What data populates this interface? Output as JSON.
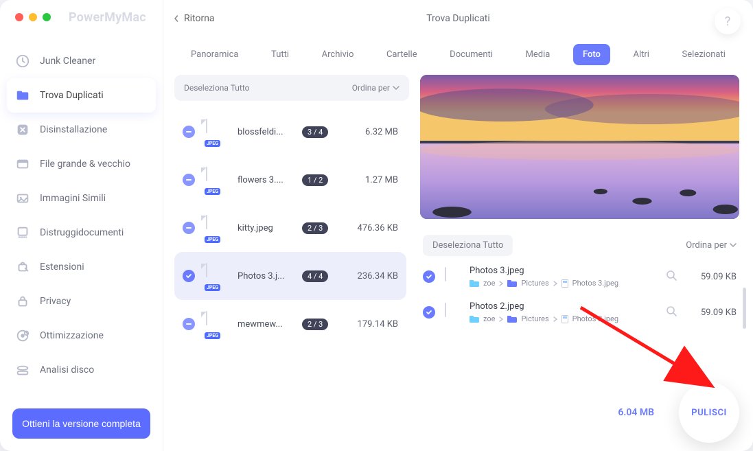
{
  "brand": "PowerMyMac",
  "back_label": "Ritorna",
  "page_title": "Trova Duplicati",
  "help_label": "?",
  "sidebar": {
    "items": [
      {
        "label": "Junk Cleaner"
      },
      {
        "label": "Trova Duplicati"
      },
      {
        "label": "Disinstallazione"
      },
      {
        "label": "File grande & vecchio"
      },
      {
        "label": "Immagini Simili"
      },
      {
        "label": "Distruggidocumenti"
      },
      {
        "label": "Estensioni"
      },
      {
        "label": "Privacy"
      },
      {
        "label": "Ottimizzazione"
      },
      {
        "label": "Analisi disco"
      }
    ],
    "cta": "Ottieni la versione completa"
  },
  "tabs": [
    "Panoramica",
    "Tutti",
    "Archivio",
    "Cartelle",
    "Documenti",
    "Media",
    "Foto",
    "Altri",
    "Selezionati"
  ],
  "tabs_active_index": 6,
  "left": {
    "deselect": "Deseleziona Tutto",
    "sort": "Ordina per",
    "rows": [
      {
        "name": "blossfeldi...",
        "badge": "3 / 4",
        "size": "6.32 MB",
        "state": "dash"
      },
      {
        "name": "flowers 3....",
        "badge": "1 / 2",
        "size": "1.27 MB",
        "state": "dash"
      },
      {
        "name": "kitty.jpeg",
        "badge": "2 / 3",
        "size": "476.36 KB",
        "state": "dash"
      },
      {
        "name": "Photos 3.j...",
        "badge": "4 / 4",
        "size": "236.34 KB",
        "state": "checked",
        "selected": true
      },
      {
        "name": "mewmew...",
        "badge": "2 / 3",
        "size": "179.14 KB",
        "state": "dash"
      }
    ]
  },
  "detail": {
    "deselect": "Deseleziona Tutto",
    "sort": "Ordina per",
    "rows": [
      {
        "name": "Photos 3.jpeg",
        "path": [
          "zoe",
          "Pictures",
          "Photos 3.jpeg"
        ],
        "size": "59.09 KB"
      },
      {
        "name": "Photos 2.jpeg",
        "path": [
          "zoe",
          "Pictures",
          "Photos 2.jpeg"
        ],
        "size": "59.09 KB"
      }
    ]
  },
  "footer": {
    "total": "6.04 MB",
    "clean": "PULISCI"
  }
}
